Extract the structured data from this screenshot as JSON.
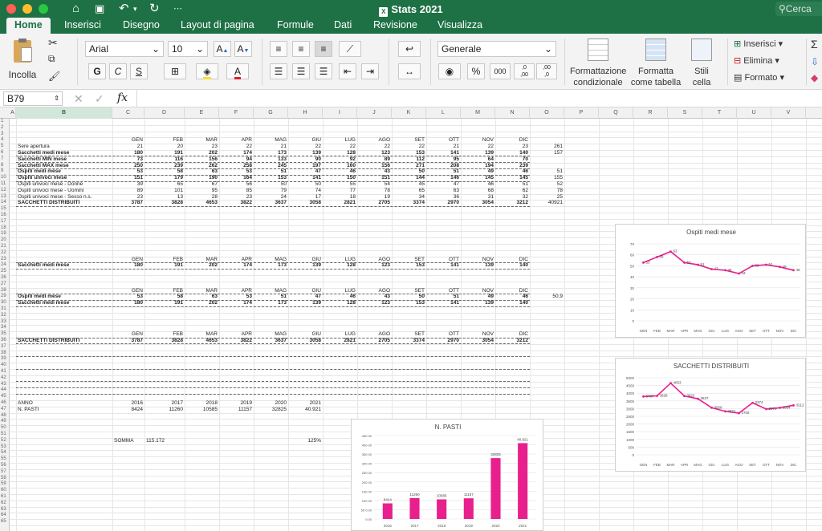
{
  "window": {
    "title": "Stats 2021",
    "search_placeholder": "Cerca"
  },
  "tabs": [
    "Home",
    "Inserisci",
    "Disegno",
    "Layout di pagina",
    "Formule",
    "Dati",
    "Revisione",
    "Visualizza"
  ],
  "ribbon": {
    "paste": "Incolla",
    "font": "Arial",
    "size": "10",
    "bold": "G",
    "italic": "C",
    "underline": "S",
    "number_format": "Generale",
    "conditional_1": "Formattazione",
    "conditional_2": "condizionale",
    "table_1": "Formatta",
    "table_2": "come tabella",
    "styles_1": "Stili",
    "styles_2": "cella",
    "insert": "Inserisci",
    "delete": "Elimina",
    "format": "Formato"
  },
  "formula_bar": {
    "name_box": "B79",
    "fx": "fx"
  },
  "selected_column": "B",
  "columns": [
    {
      "id": "A",
      "w": 8
    },
    {
      "id": "B",
      "w": 120
    },
    {
      "id": "C",
      "w": 40
    },
    {
      "id": "D",
      "w": 50
    },
    {
      "id": "E",
      "w": 43
    },
    {
      "id": "F",
      "w": 43
    },
    {
      "id": "G",
      "w": 43
    },
    {
      "id": "H",
      "w": 43
    },
    {
      "id": "I",
      "w": 43
    },
    {
      "id": "J",
      "w": 43
    },
    {
      "id": "K",
      "w": 43
    },
    {
      "id": "L",
      "w": 43
    },
    {
      "id": "M",
      "w": 43
    },
    {
      "id": "N",
      "w": 43
    },
    {
      "id": "O",
      "w": 43
    },
    {
      "id": "P",
      "w": 43
    },
    {
      "id": "Q",
      "w": 43
    },
    {
      "id": "R",
      "w": 43
    },
    {
      "id": "S",
      "w": 43
    },
    {
      "id": "T",
      "w": 43
    },
    {
      "id": "U",
      "w": 43
    },
    {
      "id": "V",
      "w": 43
    }
  ],
  "months": [
    "GEN",
    "FEB",
    "MAR",
    "APR",
    "MAG",
    "GIU",
    "LUG",
    "AGO",
    "SET",
    "OTT",
    "NOV",
    "DIC"
  ],
  "rows": [
    {
      "r": 5,
      "label": "Sere apertura",
      "v": [
        "21",
        "20",
        "23",
        "22",
        "21",
        "22",
        "22",
        "22",
        "22",
        "21",
        "22",
        "23"
      ],
      "o": "261"
    },
    {
      "r": 6,
      "label": "Sacchetti medi mese",
      "bold": true,
      "v": [
        "180",
        "191",
        "202",
        "174",
        "173",
        "139",
        "128",
        "123",
        "153",
        "141",
        "139",
        "140"
      ],
      "o": "157"
    },
    {
      "r": 7,
      "label": "Sacchetti MIN mese",
      "bold": true,
      "v": [
        "73",
        "116",
        "156",
        "94",
        "133",
        "90",
        "92",
        "89",
        "112",
        "95",
        "64",
        "70"
      ],
      "o": ""
    },
    {
      "r": 8,
      "label": "Sacchetti MAX mese",
      "bold": true,
      "v": [
        "250",
        "239",
        "262",
        "258",
        "245",
        "197",
        "160",
        "156",
        "271",
        "208",
        "194",
        "239"
      ],
      "o": ""
    },
    {
      "r": 9,
      "label": "Ospiti medi mese",
      "bold": true,
      "v": [
        "53",
        "58",
        "63",
        "53",
        "51",
        "47",
        "46",
        "43",
        "50",
        "51",
        "49",
        "46"
      ],
      "o": "51"
    },
    {
      "r": 10,
      "label": "Ospiti univoci mese",
      "bold": true,
      "v": [
        "151",
        "179",
        "190",
        "164",
        "153",
        "141",
        "150",
        "151",
        "144",
        "146",
        "145",
        "145"
      ],
      "o": "155"
    },
    {
      "r": 11,
      "label": "Ospiti univoci mese - Donne",
      "v": [
        "39",
        "65",
        "67",
        "56",
        "50",
        "50",
        "55",
        "54",
        "45",
        "47",
        "46",
        "51"
      ],
      "o": "52"
    },
    {
      "r": 12,
      "label": "Ospiti univoci mese - Uomini",
      "v": [
        "89",
        "101",
        "95",
        "85",
        "79",
        "74",
        "77",
        "78",
        "65",
        "63",
        "68",
        "62"
      ],
      "o": "78"
    },
    {
      "r": 13,
      "label": "Ospiti univoci mese - Sesso n.s.",
      "v": [
        "23",
        "13",
        "28",
        "23",
        "24",
        "17",
        "18",
        "19",
        "34",
        "36",
        "31",
        "32"
      ],
      "o": "25"
    },
    {
      "r": 14,
      "label": "SACCHETTI DISTRIBUITI",
      "bold": true,
      "v": [
        "3787",
        "3828",
        "4653",
        "3822",
        "3637",
        "3058",
        "2821",
        "2705",
        "3374",
        "2970",
        "3054",
        "3212"
      ],
      "o": "40921"
    },
    {
      "r": 23,
      "header": true
    },
    {
      "r": 24,
      "label": "Sacchetti medi mese",
      "bold": true,
      "v": [
        "180",
        "191",
        "202",
        "174",
        "173",
        "139",
        "128",
        "123",
        "153",
        "141",
        "139",
        "140"
      ],
      "o": ""
    },
    {
      "r": 28,
      "header": true
    },
    {
      "r": 29,
      "label": "Ospiti medi mese",
      "bold": true,
      "v": [
        "53",
        "58",
        "63",
        "53",
        "51",
        "47",
        "46",
        "43",
        "50",
        "51",
        "49",
        "46"
      ],
      "o": "50,9"
    },
    {
      "r": 30,
      "label": "Sacchetti medi mese",
      "bold": true,
      "v": [
        "180",
        "191",
        "202",
        "174",
        "173",
        "139",
        "128",
        "123",
        "153",
        "141",
        "139",
        "140"
      ],
      "o": ""
    },
    {
      "r": 35,
      "header": true
    },
    {
      "r": 36,
      "label": "SACCHETTI DISTRIBUITI",
      "bold": true,
      "v": [
        "3787",
        "3828",
        "4653",
        "3822",
        "3637",
        "3058",
        "2821",
        "2705",
        "3374",
        "2970",
        "3054",
        "3212"
      ],
      "o": ""
    }
  ],
  "years_table": {
    "anno_label": "ANNO",
    "pasti_label": "N. PASTI",
    "years": [
      "2016",
      "2017",
      "2018",
      "2019",
      "2020",
      "2021"
    ],
    "pasti": [
      "8424",
      "11260",
      "10585",
      "11157",
      "32825",
      "40.921"
    ]
  },
  "somma": {
    "label": "SOMMA",
    "value": "115.172",
    "pct": "125%"
  },
  "chart_data": [
    {
      "type": "line",
      "title": "Ospiti medi mese",
      "categories": [
        "GEN",
        "FEB",
        "MAR",
        "APR",
        "MAG",
        "GIU",
        "LUG",
        "AGO",
        "SET",
        "OTT",
        "NOV",
        "DIC"
      ],
      "values": [
        53,
        58,
        63,
        53,
        51,
        47,
        46,
        43,
        50,
        51,
        49,
        46
      ],
      "ylim": [
        0,
        70
      ],
      "yticks": [
        0,
        10,
        20,
        30,
        40,
        50,
        60,
        70
      ],
      "color": "#e8208d",
      "data_labels": true
    },
    {
      "type": "line",
      "title": "SACCHETTI DISTRIBUITI",
      "categories": [
        "GEN",
        "FEB",
        "MAR",
        "APR",
        "MAG",
        "GIU",
        "LUG",
        "AGO",
        "SET",
        "OTT",
        "NOV",
        "DIC"
      ],
      "values": [
        3787,
        3828,
        4653,
        3822,
        3637,
        3058,
        2821,
        2705,
        3374,
        2970,
        3054,
        3212
      ],
      "ylim": [
        0,
        5000
      ],
      "yticks": [
        0,
        500,
        1000,
        1500,
        2000,
        2500,
        3000,
        3500,
        4000,
        4500,
        5000
      ],
      "color": "#e8208d",
      "data_labels": true
    },
    {
      "type": "bar",
      "title": "N. PASTI",
      "categories": [
        "2016",
        "2017",
        "2018",
        "2019",
        "2020",
        "2021"
      ],
      "values": [
        8424,
        11260,
        10585,
        11157,
        32825,
        40921
      ],
      "value_labels": [
        "8424",
        "11260",
        "10585",
        "11157",
        "32825",
        "40.921"
      ],
      "ylim": [
        0,
        45000
      ],
      "yticks": [
        0,
        5000,
        10000,
        15000,
        20000,
        25000,
        30000,
        35000,
        40000,
        45000
      ],
      "ytick_labels": [
        "0.00",
        "50 0.00",
        "100 00",
        "150 00",
        "200 00",
        "250 00",
        "300 00",
        "350 00",
        "400 00",
        "450 00"
      ],
      "color": "#e8208d"
    }
  ]
}
